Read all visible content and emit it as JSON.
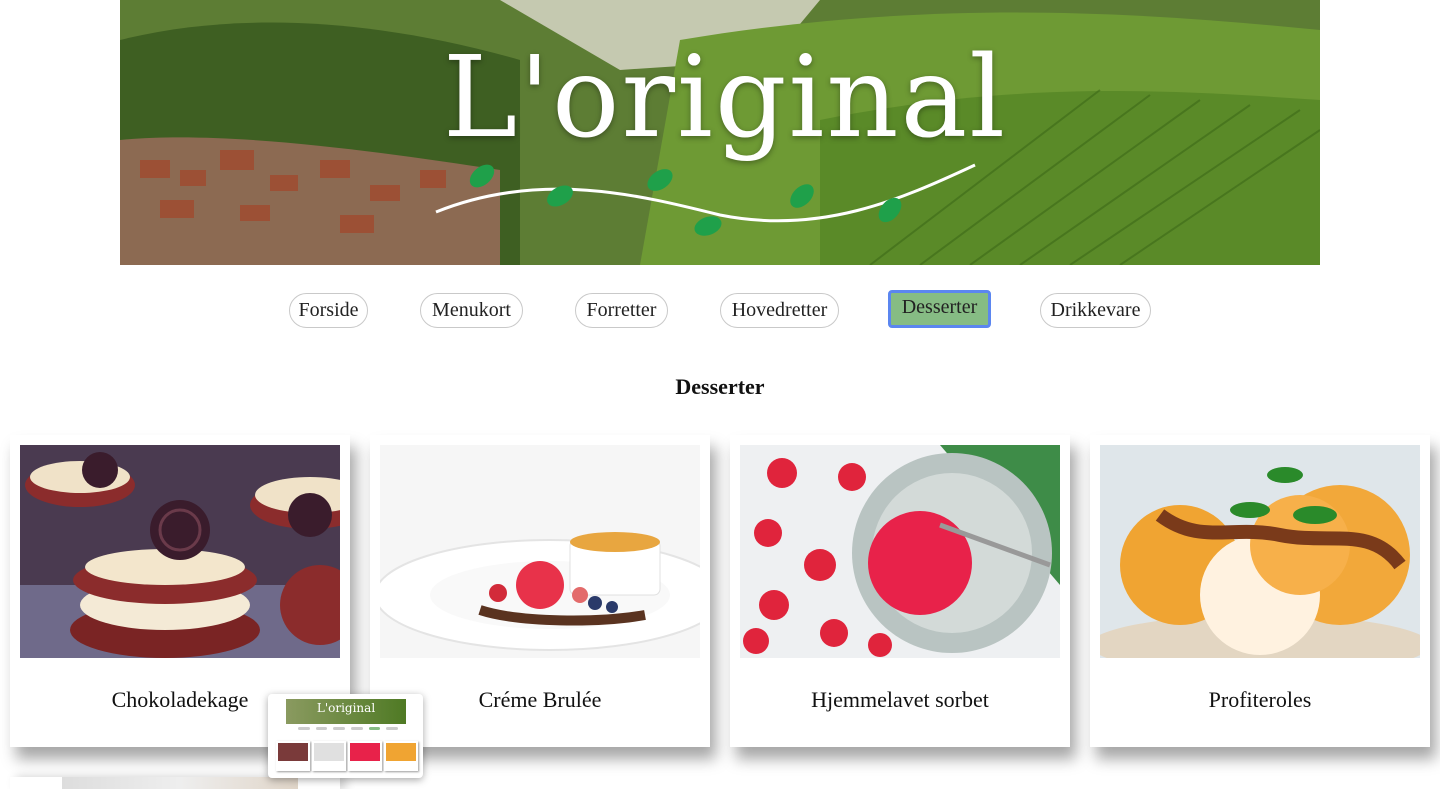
{
  "banner": {
    "logo_text": "L'original"
  },
  "nav": {
    "items": [
      {
        "label": "Forside"
      },
      {
        "label": "Menukort"
      },
      {
        "label": "Forretter"
      },
      {
        "label": "Hovedretter"
      },
      {
        "label": "Desserter",
        "active": true
      },
      {
        "label": "Drikkevare"
      }
    ]
  },
  "page": {
    "heading": "Desserter"
  },
  "cards": [
    {
      "title": "Chokoladekage"
    },
    {
      "title": "Créme Brulée"
    },
    {
      "title": "Hjemmelavet sorbet"
    },
    {
      "title": "Profiteroles"
    }
  ],
  "thumbnail": {
    "logo_text": "L'original"
  },
  "colors": {
    "active_nav": "#86bc84",
    "focus_ring": "#5b86f0",
    "banner_green": "#4f7a24"
  }
}
